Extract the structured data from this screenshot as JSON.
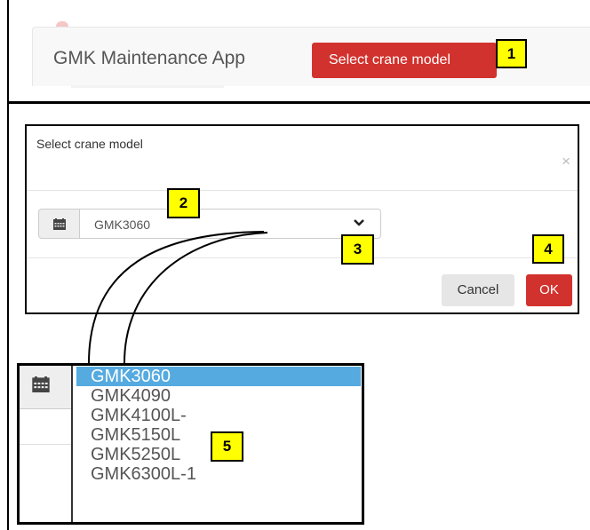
{
  "navbar": {
    "brand": "GMK Maintenance App",
    "select_button": "Select crane model"
  },
  "modal": {
    "title": "Select crane model",
    "close": "×",
    "selected_value": "GMK3060",
    "cancel_label": "Cancel",
    "ok_label": "OK"
  },
  "dropdown": {
    "options": [
      "GMK3060",
      "GMK4090",
      "GMK4100L-",
      "GMK5150L",
      "GMK5250L",
      "GMK6300L-1"
    ],
    "selected_index": 0
  },
  "badges": [
    "1",
    "2",
    "3",
    "4",
    "5"
  ],
  "colors": {
    "primary_red": "#d2322d",
    "highlight": "#55aae0",
    "badge": "#ffff00"
  },
  "icons": [
    "calendar-icon",
    "chevron-down-icon",
    "close-icon"
  ]
}
